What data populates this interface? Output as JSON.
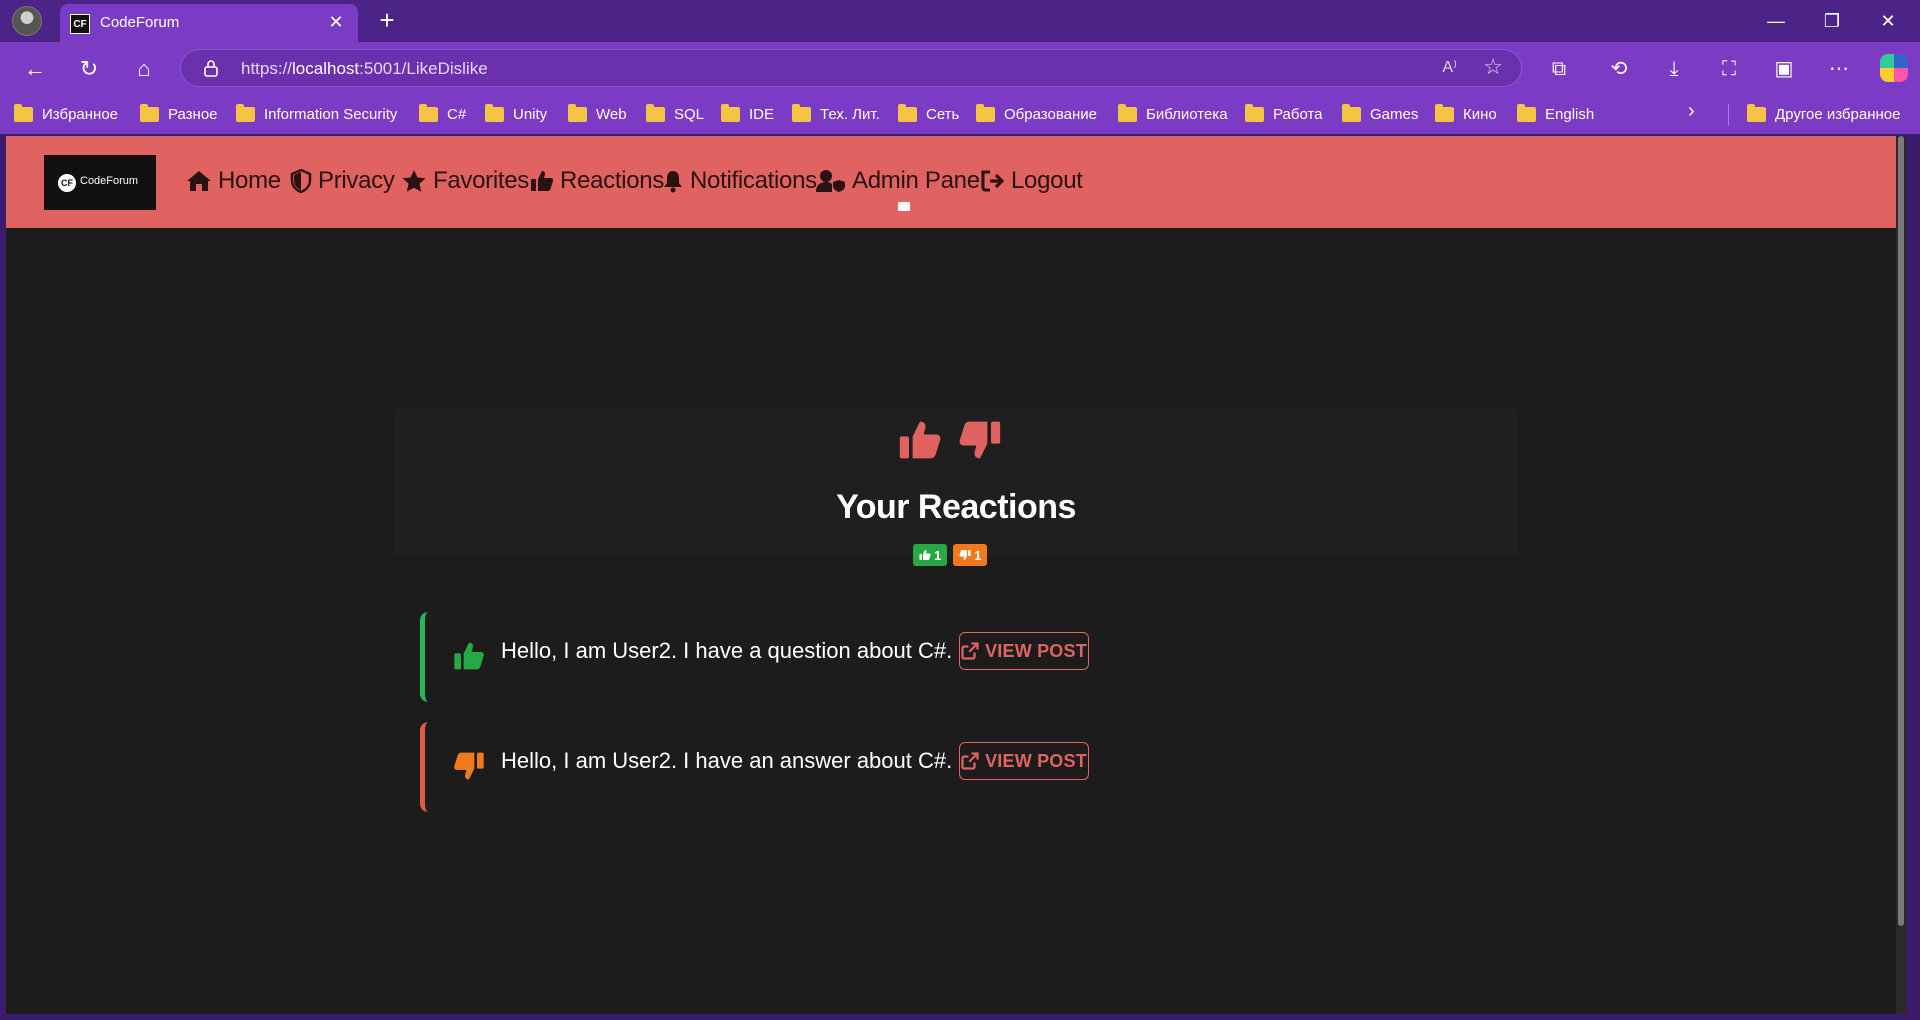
{
  "browser": {
    "tab_title": "CodeForum",
    "tab_favicon": "CF",
    "url_prefix": "https://",
    "url_host": "localhost",
    "url_rest": ":5001/LikeDislike",
    "read_aloud": "A⁾",
    "bookmarks": [
      "Избранное",
      "Разное",
      "Information Security",
      "C#",
      "Unity",
      "Web",
      "SQL",
      "IDE",
      "Тех. Лит.",
      "Сеть",
      "Образование",
      "Библиотека",
      "Работа",
      "Games",
      "Кино",
      "English"
    ],
    "other_favorites": "Другое избранное"
  },
  "navbar": {
    "brand_mark": "CF",
    "brand_text": "CodeForum",
    "links": {
      "home": "Home",
      "privacy": "Privacy",
      "favorites": "Favorites",
      "reactions": "Reactions",
      "notifications": "Notifications",
      "admin": "Admin Panel",
      "logout": "Logout"
    }
  },
  "header": {
    "title": "Your Reactions",
    "likes_count": "1",
    "dislikes_count": "1"
  },
  "reactions": [
    {
      "type": "like",
      "text": "Hello, I am User2. I have a question about C#.",
      "button": "VIEW POST"
    },
    {
      "type": "dislike",
      "text": "Hello, I am User2. I have an answer about C#.",
      "button": "VIEW POST"
    }
  ],
  "colors": {
    "navbar": "#e06361",
    "like": "#28a745",
    "dislike": "#f07a1c",
    "page_bg": "#1c1c1c"
  }
}
